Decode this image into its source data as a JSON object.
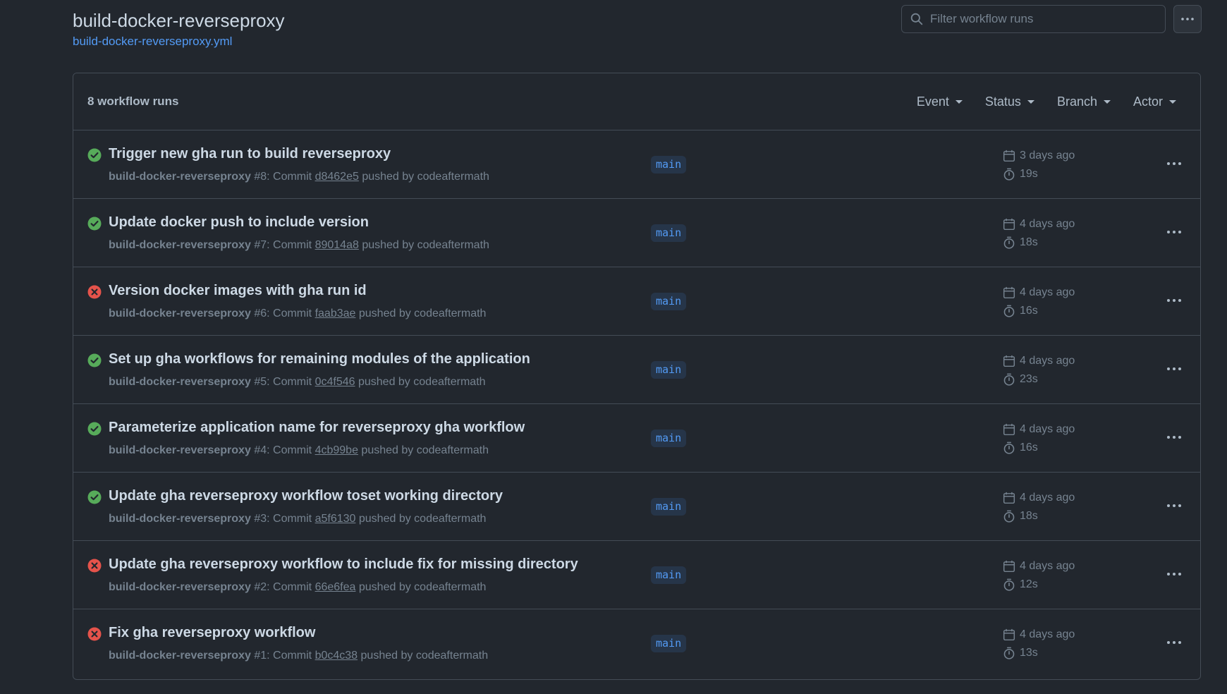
{
  "header": {
    "title": "build-docker-reverseproxy",
    "file": "build-docker-reverseproxy.yml"
  },
  "search": {
    "placeholder": "Filter workflow runs"
  },
  "list": {
    "count_label": "8 workflow runs",
    "filters": {
      "event": "Event",
      "status": "Status",
      "branch": "Branch",
      "actor": "Actor"
    }
  },
  "runs": [
    {
      "status": "success",
      "title": "Trigger new gha run to build reverseproxy",
      "workflow": "build-docker-reverseproxy",
      "number": "#8",
      "commit": "d8462e5",
      "actor": "codeaftermath",
      "branch": "main",
      "date": "3 days ago",
      "duration": "19s"
    },
    {
      "status": "success",
      "title": "Update docker push to include version",
      "workflow": "build-docker-reverseproxy",
      "number": "#7",
      "commit": "89014a8",
      "actor": "codeaftermath",
      "branch": "main",
      "date": "4 days ago",
      "duration": "18s"
    },
    {
      "status": "failure",
      "title": "Version docker images with gha run id",
      "workflow": "build-docker-reverseproxy",
      "number": "#6",
      "commit": "faab3ae",
      "actor": "codeaftermath",
      "branch": "main",
      "date": "4 days ago",
      "duration": "16s"
    },
    {
      "status": "success",
      "title": "Set up gha workflows for remaining modules of the application",
      "workflow": "build-docker-reverseproxy",
      "number": "#5",
      "commit": "0c4f546",
      "actor": "codeaftermath",
      "branch": "main",
      "date": "4 days ago",
      "duration": "23s"
    },
    {
      "status": "success",
      "title": "Parameterize application name for reverseproxy gha workflow",
      "workflow": "build-docker-reverseproxy",
      "number": "#4",
      "commit": "4cb99be",
      "actor": "codeaftermath",
      "branch": "main",
      "date": "4 days ago",
      "duration": "16s"
    },
    {
      "status": "success",
      "title": "Update gha reverseproxy workflow toset working directory",
      "workflow": "build-docker-reverseproxy",
      "number": "#3",
      "commit": "a5f6130",
      "actor": "codeaftermath",
      "branch": "main",
      "date": "4 days ago",
      "duration": "18s"
    },
    {
      "status": "failure",
      "title": "Update gha reverseproxy workflow to include fix for missing directory",
      "workflow": "build-docker-reverseproxy",
      "number": "#2",
      "commit": "66e6fea",
      "actor": "codeaftermath",
      "branch": "main",
      "date": "4 days ago",
      "duration": "12s"
    },
    {
      "status": "failure",
      "title": "Fix gha reverseproxy workflow",
      "workflow": "build-docker-reverseproxy",
      "number": "#1",
      "commit": "b0c4c38",
      "actor": "codeaftermath",
      "branch": "main",
      "date": "4 days ago",
      "duration": "13s"
    }
  ],
  "text": {
    "commit_prefix": "Commit",
    "pushed_by": "pushed by"
  },
  "colors": {
    "success": "#57ab5a",
    "failure": "#e5534b",
    "link": "#539bf5",
    "background": "#22272e"
  },
  "icons": {
    "success": "check-circle-icon",
    "failure": "x-circle-icon",
    "date": "calendar-icon",
    "duration": "stopwatch-icon",
    "search": "search-icon",
    "more": "kebab-horizontal-icon"
  }
}
